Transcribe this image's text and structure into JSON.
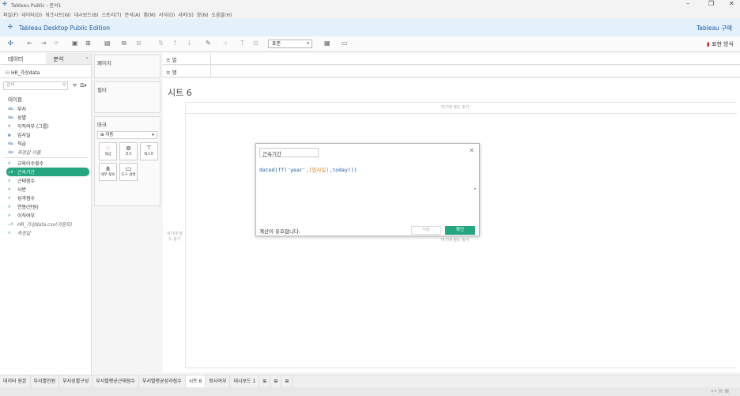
{
  "window": {
    "title": "Tableau Public - 문서1"
  },
  "menu": [
    "파일(F)",
    "데이터(D)",
    "워크시트(W)",
    "대시보드(B)",
    "스토리(T)",
    "분석(A)",
    "맵(M)",
    "서식(O)",
    "서버(S)",
    "창(N)",
    "도움말(H)"
  ],
  "banner": {
    "edition": "Tableau Desktop Public Edition",
    "buy": "Tableau 구매"
  },
  "toolbar": {
    "view_select": "표준",
    "present": "표현 방식"
  },
  "left": {
    "tab_data": "데이터",
    "tab_analysis": "분석",
    "datasource": "HR_가상data",
    "search_placeholder": "검색",
    "tables_header": "테이블",
    "dimensions": [
      {
        "icon": "Abc",
        "label": "부서"
      },
      {
        "icon": "Abc",
        "label": "성별"
      },
      {
        "icon": "#",
        "label": "이직여부 (그룹)"
      },
      {
        "icon": "▦",
        "label": "입사일"
      },
      {
        "icon": "Abc",
        "label": "직급"
      },
      {
        "icon": "Abc",
        "label": "측정값 이름"
      }
    ],
    "measures": [
      {
        "icon": "#",
        "label": "교육이수횟수"
      },
      {
        "icon": "=#",
        "label": "근속기간"
      },
      {
        "icon": "#",
        "label": "근태점수"
      },
      {
        "icon": "#",
        "label": "사번"
      },
      {
        "icon": "#",
        "label": "성과점수"
      },
      {
        "icon": "#",
        "label": "연봉(만원)"
      },
      {
        "icon": "#",
        "label": "이직여부"
      },
      {
        "icon": "=#",
        "label": "HR_가상data.csv(카운트)"
      },
      {
        "icon": "#",
        "label": "측정값"
      }
    ]
  },
  "mid": {
    "pages": "페이지",
    "filters": "필터",
    "marks": "마크",
    "mark_type": "자동",
    "mark_buttons": [
      "색상",
      "크기",
      "텍스트",
      "세부 정보",
      "도구 설명"
    ]
  },
  "shelves": {
    "columns": "열",
    "rows": "행"
  },
  "sheet": {
    "title": "시트 6",
    "drop_top": "여기에 필드 놓기",
    "drop_left": "여기에 필드 놓기",
    "drop_center": "여기에 필드 놓기"
  },
  "dialog": {
    "name": "근속기간",
    "formula_a": "datediff('year',",
    "formula_field": "[입사일]",
    "formula_b": ",today())",
    "valid": "계산이 유효합니다.",
    "apply": "적용",
    "ok": "확인"
  },
  "sheet_tabs": [
    "데이터 원본",
    "부서별인원",
    "부서성별구성",
    "부서별평균근태점수",
    "부서별평균성과점수",
    "시트 6",
    "퇴사여부",
    "대시보드 1"
  ]
}
